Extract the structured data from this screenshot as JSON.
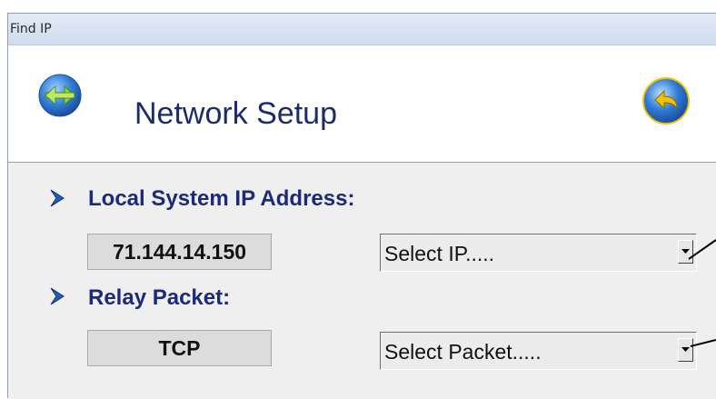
{
  "window": {
    "title": "Find IP"
  },
  "header": {
    "icon": "network-arrows-icon",
    "title": "Network Setup",
    "back_icon": "back-arrow-icon"
  },
  "local_ip": {
    "label": "Local System  IP Address:",
    "value": "71.144.14.150",
    "select_value": "Select IP.....",
    "bullet_icon": "chevron-right-icon"
  },
  "relay": {
    "label": "Relay Packet:",
    "value": "TCP",
    "select_value": "Select Packet.....",
    "bullet_icon": "chevron-right-icon"
  },
  "colors": {
    "label_text": "#1c2a78",
    "icon_blue": "#2f7bd6",
    "icon_green": "#8ed43a",
    "icon_yellow": "#f2c200"
  }
}
